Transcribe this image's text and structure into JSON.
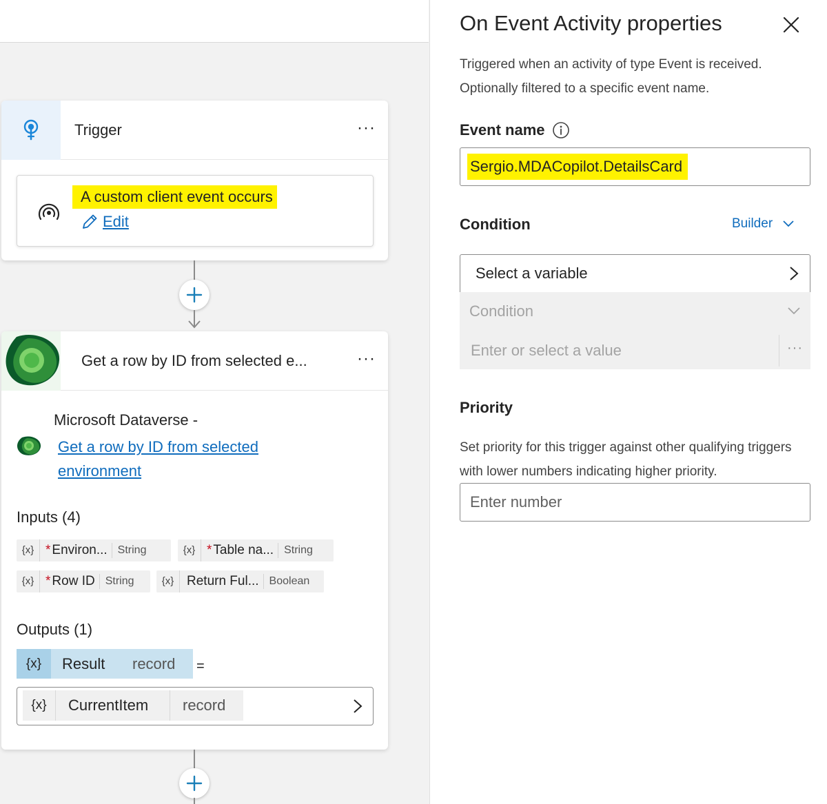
{
  "canvas": {
    "trigger": {
      "title": "Trigger",
      "more": "···",
      "event_text": "A custom client event occurs",
      "edit_label": "Edit"
    },
    "action": {
      "title": "Get a row by ID from selected e...",
      "more": "···",
      "connector_label": "Microsoft Dataverse  -",
      "action_link": "Get a row by ID from selected environment",
      "inputs_label": "Inputs (4)",
      "inputs": [
        {
          "var": "{x}",
          "required": "*",
          "name": "Environ...",
          "type": "String"
        },
        {
          "var": "{x}",
          "required": "*",
          "name": "Table na...",
          "type": "String"
        },
        {
          "var": "{x}",
          "required": "*",
          "name": "Row ID",
          "type": "String"
        },
        {
          "var": "{x}",
          "required": "",
          "name": "Return Ful...",
          "type": "Boolean"
        }
      ],
      "outputs_label": "Outputs (1)",
      "output": {
        "var": "{x}",
        "name": "Result",
        "type": "record",
        "equals": "="
      },
      "assigned": {
        "var": "{x}",
        "name": "CurrentItem",
        "type": "record"
      }
    }
  },
  "panel": {
    "title": "On Event Activity properties",
    "description": "Triggered when an activity of type Event is received. Optionally filtered to a specific event name.",
    "event_name_label": "Event name",
    "event_name_value": "Sergio.MDACopilot.DetailsCard",
    "condition_label": "Condition",
    "condition_mode": "Builder",
    "select_variable": "Select a variable",
    "condition_operator_placeholder": "Condition",
    "condition_value_placeholder": "Enter or select a value",
    "condition_more": "···",
    "priority_label": "Priority",
    "priority_description": "Set priority for this trigger against other qualifying triggers with lower numbers indicating higher priority.",
    "priority_placeholder": "Enter number"
  },
  "colors": {
    "accent": "#0f6cbd",
    "highlight": "#fff200",
    "output_chip": "#c9e2f0"
  },
  "icons": {
    "trigger": "lightbulb-signal-icon",
    "event": "broadcast-icon",
    "edit": "pencil-icon",
    "dataverse": "dataverse-logo-icon",
    "add": "plus-icon",
    "close": "close-icon",
    "info": "info-icon"
  }
}
